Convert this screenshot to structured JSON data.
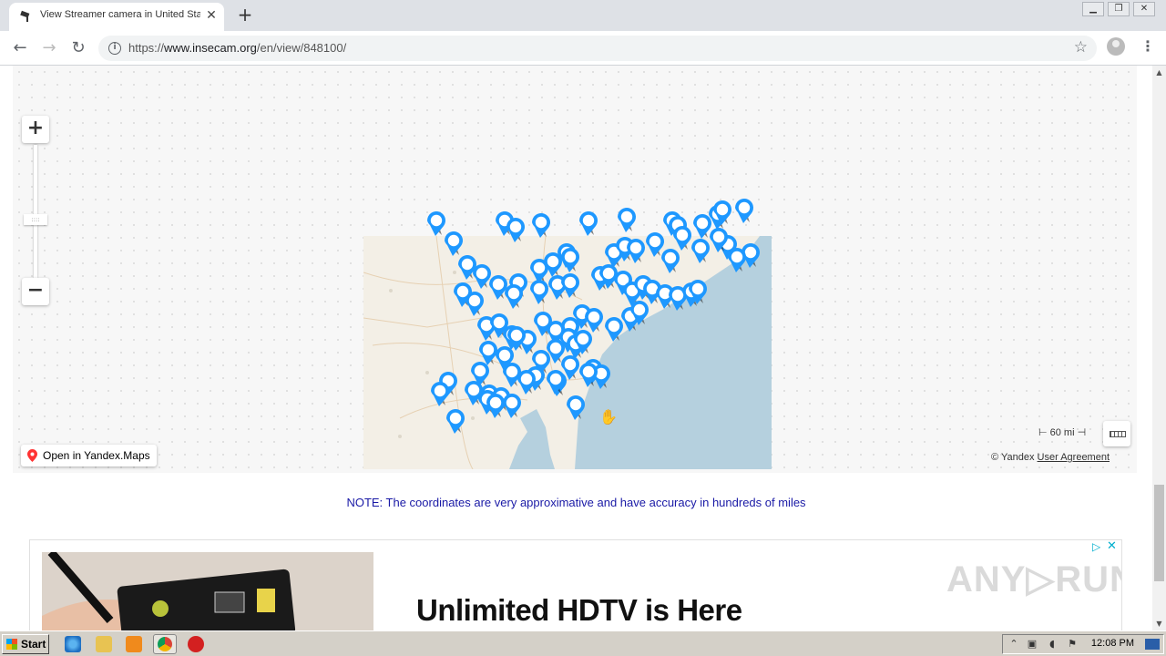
{
  "browser": {
    "tab_title": "View Streamer camera in United Stat",
    "url_prefix": "https://",
    "url_host": "www.insecam.org",
    "url_path": "/en/view/848100/"
  },
  "map": {
    "open_yandex_label": "Open in Yandex.Maps",
    "scale_label": "⊢ 60 mi ⊣",
    "copyright": "© Yandex",
    "user_agreement": "User Agreement"
  },
  "note": "NOTE: The coordinates are very approximative and have accuracy in hundreds of miles",
  "ad": {
    "headline": "Unlimited HDTV is Here",
    "watermark": "ANY▷RUN"
  },
  "taskbar": {
    "start_label": "Start",
    "clock": "12:08 PM"
  },
  "colors": {
    "marker": "#1e98ff",
    "note_text": "#1a1aa6",
    "water": "#b5d0de"
  }
}
